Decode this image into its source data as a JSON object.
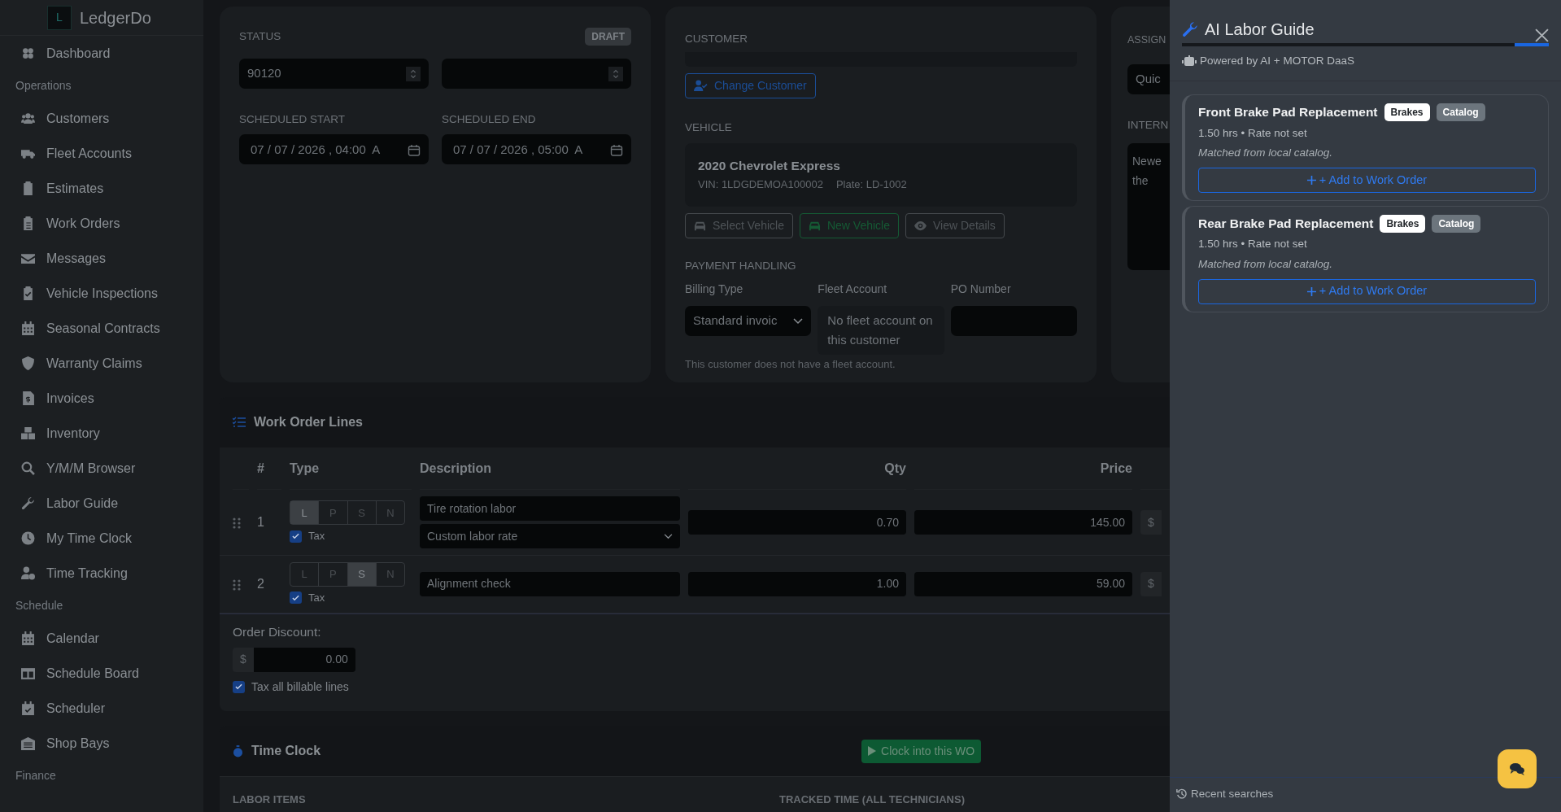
{
  "sidebar": {
    "brand": {
      "logo_letter": "L",
      "name": "LedgerDo"
    },
    "sections": [
      {
        "items": [
          {
            "label": "Dashboard"
          }
        ]
      },
      {
        "heading": "Operations",
        "items": [
          {
            "label": "Customers"
          },
          {
            "label": "Fleet Accounts"
          },
          {
            "label": "Estimates"
          },
          {
            "label": "Work Orders"
          },
          {
            "label": "Messages"
          },
          {
            "label": "Vehicle Inspections"
          },
          {
            "label": "Seasonal Contracts"
          },
          {
            "label": "Warranty Claims"
          },
          {
            "label": "Invoices"
          },
          {
            "label": "Inventory"
          },
          {
            "label": "Y/M/M Browser"
          },
          {
            "label": "Labor Guide"
          },
          {
            "label": "My Time Clock"
          },
          {
            "label": "Time Tracking"
          }
        ]
      },
      {
        "heading": "Schedule",
        "items": [
          {
            "label": "Calendar"
          },
          {
            "label": "Schedule Board"
          },
          {
            "label": "Scheduler"
          },
          {
            "label": "Shop Bays"
          }
        ]
      },
      {
        "heading": "Finance"
      }
    ]
  },
  "status_card": {
    "label": "STATUS",
    "badge": "DRAFT",
    "number_value": "90120",
    "schedule": [
      {
        "label": "SCHEDULED START",
        "value": "07 / 07 / 2026 , 04:00  A"
      },
      {
        "label": "SCHEDULED END",
        "value": "07 / 07 / 2026 , 05:00  A"
      }
    ]
  },
  "customer_card": {
    "customer_label": "CUSTOMER",
    "change_button": "Change Customer",
    "vehicle_label": "VEHICLE",
    "vehicle": {
      "name": "2020 Chevrolet Express",
      "vin": "VIN: 1LDGDEMOA100002",
      "plate": "Plate: LD-1002"
    },
    "vehicle_buttons": [
      "Select Vehicle",
      "New Vehicle",
      "View Details"
    ],
    "payment_label": "PAYMENT HANDLING",
    "billing": {
      "label": "Billing Type",
      "value": "Standard invoic"
    },
    "fleet": {
      "label": "Fleet Account",
      "value": "No fleet account on this customer"
    },
    "po": {
      "label": "PO Number"
    },
    "note": "This customer does not have a fleet account."
  },
  "assign_card": {
    "label": "ASSIGN",
    "quick_value": "Quic",
    "notes_label": "INTERN",
    "notes_lines": [
      "Newe",
      "the"
    ]
  },
  "work_order_lines": {
    "title": "Work Order Lines",
    "columns": [
      "#",
      "Type",
      "Description",
      "Qty",
      "Price"
    ],
    "rows": [
      {
        "number": "1",
        "types": [
          {
            "label": "L",
            "selected": true
          },
          {
            "label": "P",
            "selected": false
          },
          {
            "label": "S",
            "selected": false
          },
          {
            "label": "N",
            "selected": false
          }
        ],
        "tax": {
          "label": "Tax",
          "checked": true
        },
        "description": "Tire rotation labor",
        "rate": "Custom labor rate",
        "qty": "0.70",
        "price": "145.00",
        "currency": "$"
      },
      {
        "number": "2",
        "types": [
          {
            "label": "L",
            "selected": false
          },
          {
            "label": "P",
            "selected": false
          },
          {
            "label": "S",
            "selected": true
          },
          {
            "label": "N",
            "selected": false
          }
        ],
        "tax": {
          "label": "Tax",
          "checked": true
        },
        "description": "Alignment check",
        "qty": "1.00",
        "price": "59.00",
        "currency": "$"
      }
    ],
    "discount": {
      "label": "Order Discount:",
      "currency": "$",
      "value": "0.00"
    },
    "tax_all": {
      "label": "Tax all billable lines",
      "checked": true
    }
  },
  "time_clock": {
    "title": "Time Clock",
    "button": "Clock into this WO",
    "columns": [
      "LABOR ITEMS",
      "TRACKED TIME (ALL TECHNICIANS)"
    ]
  },
  "labor_guide": {
    "title": "AI Labor Guide",
    "powered": "Powered by AI + MOTOR DaaS",
    "results": [
      {
        "title": "Front Brake Pad Replacement",
        "tags": [
          {
            "label": "Brakes",
            "kind": "category"
          },
          {
            "label": "Catalog",
            "kind": "source"
          }
        ],
        "meta": "1.50 hrs • Rate not set",
        "note": "Matched from local catalog.",
        "button": "+ Add to Work Order"
      },
      {
        "title": "Rear Brake Pad Replacement",
        "tags": [
          {
            "label": "Brakes",
            "kind": "category"
          },
          {
            "label": "Catalog",
            "kind": "source"
          }
        ],
        "meta": "1.50 hrs • Rate not set",
        "note": "Matched from local catalog.",
        "button": "+ Add to Work Order"
      }
    ],
    "footer": "Recent searches"
  }
}
